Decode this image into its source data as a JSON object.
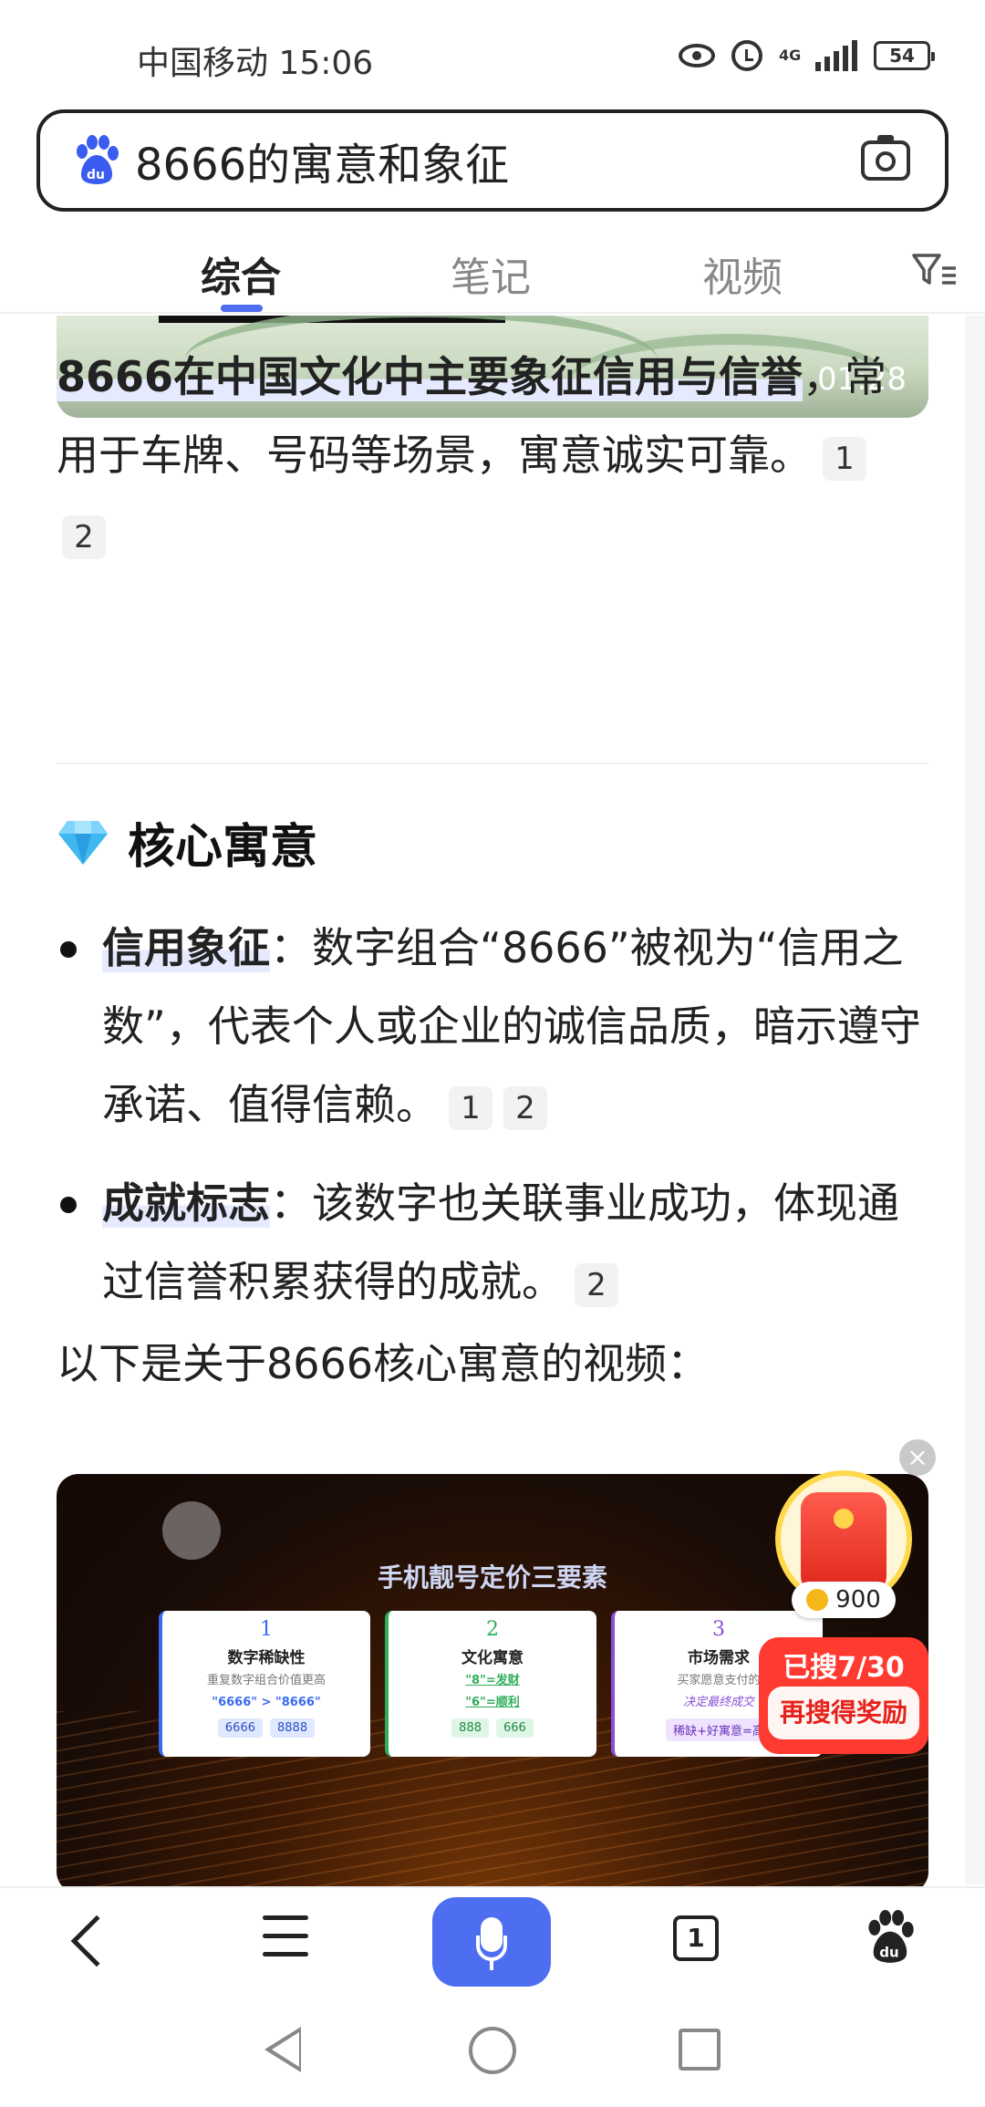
{
  "status_bar": {
    "carrier_time": "中国移动 15:06",
    "network": "4G",
    "battery": "54"
  },
  "search": {
    "query": "8666的寓意和象征"
  },
  "tabs": [
    {
      "label": "综合",
      "active": true
    },
    {
      "label": "笔记",
      "active": false
    },
    {
      "label": "视频",
      "active": false
    }
  ],
  "video_top": {
    "duration": "01:28"
  },
  "summary": {
    "highlight": "8666在中国文化中主要象征信用与信誉",
    "text": "，常用于车牌、号码等场景，寓意诚实可靠。",
    "cite1": "1",
    "cite2": "2"
  },
  "section": {
    "title": "核心寓意"
  },
  "bullets": [
    {
      "term": "信用象征",
      "text": "：数字组合“8666”被视为“信用之数”，代表个人或企业的诚信品质，暗示遵守承诺、值得信赖。",
      "cite1": "1",
      "cite2": "2"
    },
    {
      "term": "成就标志",
      "text": "：该数字也关联事业成功，体现通过信誉积累获得的成就。",
      "cite1": "2"
    }
  ],
  "video_intro": "以下是关于8666核心寓意的视频：",
  "video2": {
    "title": "手机靓号定价三要素",
    "cards": [
      {
        "num": "1",
        "name": "数字稀缺性",
        "desc": "重复数字组合价值更高",
        "desc2": "\"6666\" > \"8666\"",
        "chips": [
          "6666",
          "8888"
        ]
      },
      {
        "num": "2",
        "name": "文化寓意",
        "desc": "\"8\"=发财",
        "desc2": "\"6\"=顺利",
        "chips": [
          "888",
          "666"
        ]
      },
      {
        "num": "3",
        "name": "市场需求",
        "desc": "买家愿意支付的",
        "desc2": "决定最终成交",
        "chips": [
          "稀缺+好寓意=高"
        ]
      }
    ]
  },
  "reward": {
    "coins": "900",
    "progress": "已搜7/30",
    "button": "再搜得奖励"
  },
  "colors": {
    "accent": "#4e6ef2",
    "promo_red": "#ff3a30"
  },
  "bottom_nav": {
    "tabs_count": "1"
  }
}
